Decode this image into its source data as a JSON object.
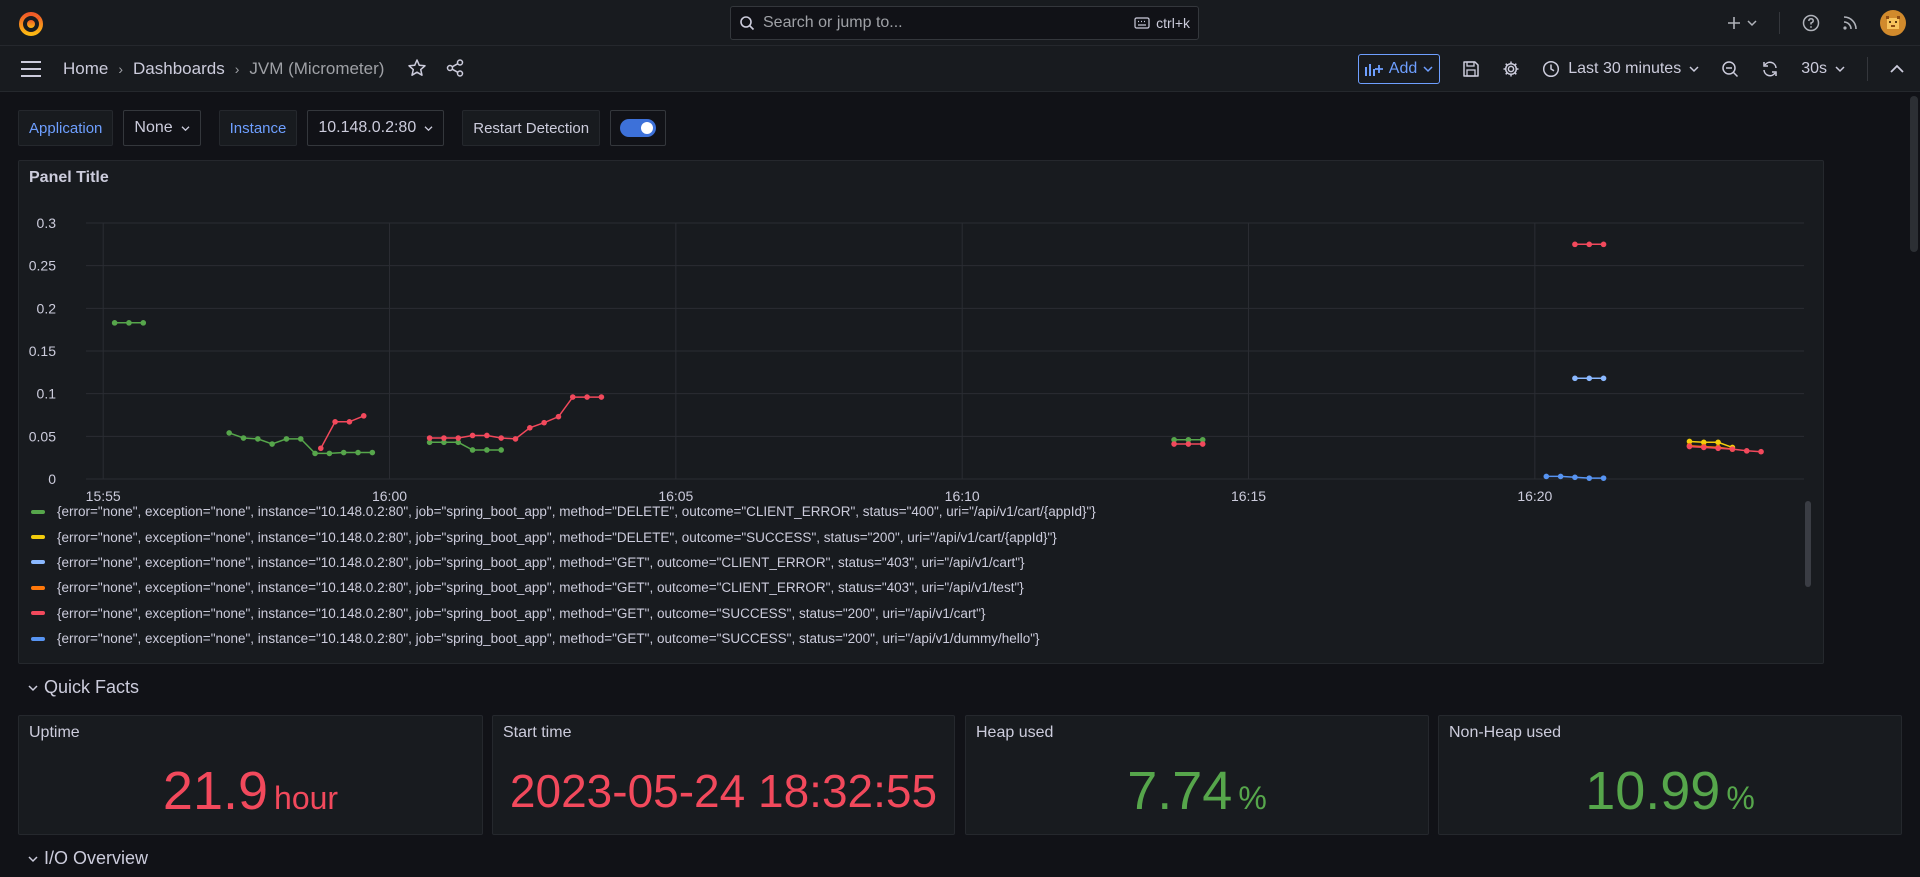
{
  "topbar": {
    "search_placeholder": "Search or jump to...",
    "search_shortcut": "ctrl+k",
    "icons": [
      "grafana-logo-icon",
      "plus-icon",
      "help-icon",
      "rss-icon",
      "avatar"
    ]
  },
  "navbar": {
    "breadcrumbs": [
      "Home",
      "Dashboards",
      "JVM (Micrometer)"
    ],
    "add_label": "Add",
    "time_range": "Last 30 minutes",
    "refresh_interval": "30s"
  },
  "variables": {
    "application_label": "Application",
    "application_value": "None",
    "instance_label": "Instance",
    "instance_value": "10.148.0.2:80",
    "restart_label": "Restart Detection",
    "restart_enabled": true
  },
  "panel": {
    "title": "Panel Title",
    "legend": [
      {
        "label": "{error=\"none\", exception=\"none\", instance=\"10.148.0.2:80\", job=\"spring_boot_app\", method=\"DELETE\", outcome=\"CLIENT_ERROR\", status=\"400\", uri=\"/api/v1/cart/{appId}\"}",
        "color": "#56a64b"
      },
      {
        "label": "{error=\"none\", exception=\"none\", instance=\"10.148.0.2:80\", job=\"spring_boot_app\", method=\"DELETE\", outcome=\"SUCCESS\", status=\"200\", uri=\"/api/v1/cart/{appId}\"}",
        "color": "#f2cc0c"
      },
      {
        "label": "{error=\"none\", exception=\"none\", instance=\"10.148.0.2:80\", job=\"spring_boot_app\", method=\"GET\", outcome=\"CLIENT_ERROR\", status=\"403\", uri=\"/api/v1/cart\"}",
        "color": "#8ab8ff"
      },
      {
        "label": "{error=\"none\", exception=\"none\", instance=\"10.148.0.2:80\", job=\"spring_boot_app\", method=\"GET\", outcome=\"CLIENT_ERROR\", status=\"403\", uri=\"/api/v1/test\"}",
        "color": "#ff780a"
      },
      {
        "label": "{error=\"none\", exception=\"none\", instance=\"10.148.0.2:80\", job=\"spring_boot_app\", method=\"GET\", outcome=\"SUCCESS\", status=\"200\", uri=\"/api/v1/cart\"}",
        "color": "#f2495c"
      },
      {
        "label": "{error=\"none\", exception=\"none\", instance=\"10.148.0.2:80\", job=\"spring_boot_app\", method=\"GET\", outcome=\"SUCCESS\", status=\"200\", uri=\"/api/v1/dummy/hello\"}",
        "color": "#5794f2"
      }
    ]
  },
  "chart_data": {
    "type": "line",
    "title": "Panel Title",
    "x_ticks": [
      "15:55",
      "16:00",
      "16:05",
      "16:10",
      "16:15",
      "16:20"
    ],
    "y_ticks": [
      "0",
      "0.05",
      "0.1",
      "0.15",
      "0.2",
      "0.25",
      "0.3"
    ],
    "xlim": [
      "15:54.7",
      "16:24.7"
    ],
    "ylim": [
      0,
      0.3
    ],
    "grid": true,
    "series": [
      {
        "color": "#56a64b",
        "segments": [
          [
            [
              "15:55.2",
              0.183
            ],
            [
              "15:55.45",
              0.183
            ],
            [
              "15:55.7",
              0.183
            ]
          ],
          [
            [
              "15:57.2",
              0.054
            ],
            [
              "15:57.45",
              0.048
            ],
            [
              "15:57.7",
              0.047
            ],
            [
              "15:57.95",
              0.041
            ],
            [
              "15:58.2",
              0.047
            ],
            [
              "15:58.45",
              0.047
            ],
            [
              "15:58.7",
              0.03
            ],
            [
              "15:58.95",
              0.03
            ],
            [
              "15:59.2",
              0.031
            ],
            [
              "15:59.45",
              0.031
            ],
            [
              "15:59.7",
              0.031
            ]
          ],
          [
            [
              "16:00.7",
              0.043
            ],
            [
              "16:00.95",
              0.043
            ],
            [
              "16:01.2",
              0.043
            ],
            [
              "16:01.45",
              0.034
            ],
            [
              "16:01.7",
              0.034
            ],
            [
              "16:01.95",
              0.034
            ]
          ],
          [
            [
              "16:13.7",
              0.046
            ],
            [
              "16:13.95",
              0.046
            ],
            [
              "16:14.2",
              0.046
            ]
          ]
        ]
      },
      {
        "color": "#f2cc0c",
        "segments": [
          [
            [
              "16:22.7",
              0.044
            ],
            [
              "16:22.95",
              0.043
            ],
            [
              "16:23.2",
              0.043
            ],
            [
              "16:23.45",
              0.037
            ]
          ]
        ]
      },
      {
        "color": "#8ab8ff",
        "segments": [
          [
            [
              "16:20.7",
              0.118
            ],
            [
              "16:20.95",
              0.118
            ],
            [
              "16:21.2",
              0.118
            ]
          ]
        ]
      },
      {
        "color": "#ff780a",
        "segments": [
          [
            [
              "16:22.7",
              0.039
            ],
            [
              "16:22.95",
              0.038
            ],
            [
              "16:23.2",
              0.037
            ],
            [
              "16:23.45",
              0.035
            ]
          ]
        ]
      },
      {
        "color": "#f2495c",
        "segments": [
          [
            [
              "15:58.8",
              0.036
            ],
            [
              "15:59.05",
              0.067
            ],
            [
              "15:59.3",
              0.067
            ],
            [
              "15:59.55",
              0.074
            ]
          ],
          [
            [
              "16:00.7",
              0.048
            ],
            [
              "16:00.95",
              0.048
            ],
            [
              "16:01.2",
              0.048
            ],
            [
              "16:01.45",
              0.051
            ],
            [
              "16:01.7",
              0.051
            ],
            [
              "16:01.95",
              0.048
            ],
            [
              "16:02.2",
              0.047
            ],
            [
              "16:02.45",
              0.06
            ],
            [
              "16:02.7",
              0.066
            ],
            [
              "16:02.95",
              0.073
            ],
            [
              "16:03.2",
              0.096
            ],
            [
              "16:03.45",
              0.096
            ],
            [
              "16:03.7",
              0.096
            ]
          ],
          [
            [
              "16:13.7",
              0.041
            ],
            [
              "16:13.95",
              0.041
            ],
            [
              "16:14.2",
              0.041
            ]
          ],
          [
            [
              "16:20.7",
              0.275
            ],
            [
              "16:20.95",
              0.275
            ],
            [
              "16:21.2",
              0.275
            ]
          ],
          [
            [
              "16:22.7",
              0.038
            ],
            [
              "16:22.95",
              0.037
            ],
            [
              "16:23.2",
              0.036
            ],
            [
              "16:23.45",
              0.035
            ],
            [
              "16:23.7",
              0.033
            ],
            [
              "16:23.95",
              0.032
            ]
          ]
        ]
      },
      {
        "color": "#5794f2",
        "segments": [
          [
            [
              "16:20.2",
              0.003
            ],
            [
              "16:20.45",
              0.003
            ],
            [
              "16:20.7",
              0.002
            ],
            [
              "16:20.95",
              0.001
            ],
            [
              "16:21.2",
              0.001
            ]
          ]
        ]
      }
    ]
  },
  "rows": {
    "quick_facts": "Quick Facts",
    "io_overview": "I/O Overview"
  },
  "stats": [
    {
      "title": "Uptime",
      "value": "21.9",
      "unit": "hour",
      "color": "#f2495c"
    },
    {
      "title": "Start time",
      "value": "2023-05-24 18:32:55",
      "unit": "",
      "color": "#f2495c"
    },
    {
      "title": "Heap used",
      "value": "7.74",
      "unit": "%",
      "color": "#56a64b"
    },
    {
      "title": "Non-Heap used",
      "value": "10.99",
      "unit": "%",
      "color": "#56a64b"
    }
  ]
}
